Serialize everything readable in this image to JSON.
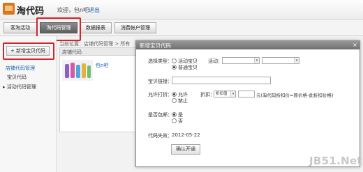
{
  "header": {
    "logo_text": "淘代码",
    "welcome": "欢迎，",
    "username": "包n吧",
    "logout": "退出"
  },
  "tabs": [
    {
      "label": "客淘活动"
    },
    {
      "label": "淘代码管理"
    },
    {
      "label": "数据报表"
    },
    {
      "label": "消费帐户管理"
    }
  ],
  "sidebar": {
    "add_button": "+ 新增宝贝代码",
    "items": [
      {
        "label": "店铺代码管理"
      },
      {
        "label": "宝贝代码"
      },
      {
        "label": "▸ 活动代码管理"
      }
    ]
  },
  "main": {
    "breadcrumb": "当前位置：店铺代码管理 > 所有",
    "panel_title": "店铺代码",
    "thumb_label": "包n吧"
  },
  "dialog": {
    "title": "新增宝贝代码",
    "close": "×",
    "select_type_label": "选择类型：",
    "activity_option": "活动宝贝",
    "normal_option": "普通宝贝",
    "activity_label": "活动：",
    "link_label": "宝贝链接：",
    "allow_discount_label": "允许打折：",
    "allow_option": "允许",
    "forbid_option": "禁止",
    "discount_label": "折扣：",
    "discount_select": "折扣值",
    "discount_hint": "元(淘代码折扣价=原价格-此折扣价格)",
    "free_shipping_label": "是否包邮：",
    "yes_option": "是",
    "no_option": "否",
    "expire_label": "代码失效：",
    "expire_value": "2012-05-22",
    "confirm_button": "确认开通"
  },
  "watermark": "JB51.Net"
}
